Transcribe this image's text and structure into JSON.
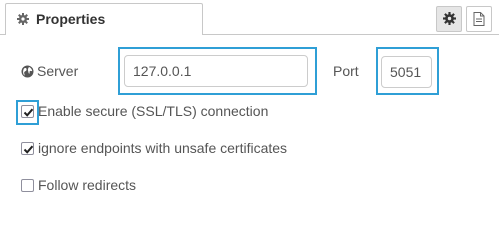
{
  "tabs": {
    "properties_label": "Properties"
  },
  "toolbar": {
    "settings_icon": "gear-icon",
    "info_icon": "document-icon"
  },
  "server": {
    "label": "Server",
    "icon": "globe-icon",
    "value": "127.0.0.1",
    "port_label": "Port",
    "port_value": "5051"
  },
  "options": [
    {
      "label": "Enable secure (SSL/TLS) connection",
      "checked": true
    },
    {
      "label": "ignore endpoints with unsafe certificates",
      "checked": true
    },
    {
      "label": "Follow redirects",
      "checked": false
    }
  ],
  "colors": {
    "highlight": "#2f9fd6",
    "border": "#c8c8c8",
    "text": "#555555"
  }
}
